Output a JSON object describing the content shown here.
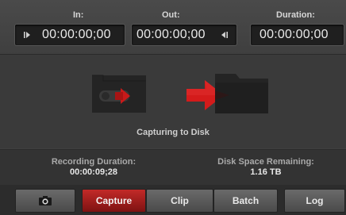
{
  "timecode": {
    "in_label": "In:",
    "out_label": "Out:",
    "duration_label": "Duration:",
    "in_value": "00:00:00;00",
    "out_value": "00:00:00;00",
    "duration_value": "00:00:00;00",
    "mark_in_icon": "mark-in-icon",
    "mark_out_icon": "mark-out-icon"
  },
  "stage": {
    "status": "Capturing to Disk",
    "icons": [
      "tape-icon",
      "arrow-right-icon",
      "folder-icon"
    ],
    "accent": "#d01818"
  },
  "info": {
    "recording_label": "Recording Duration:",
    "recording_value": "00:00:09;28",
    "disk_label": "Disk Space Remaining:",
    "disk_value": "1.16 TB"
  },
  "tabs": {
    "camera_icon": "camera-icon",
    "capture": "Capture",
    "clip": "Clip",
    "batch": "Batch",
    "log": "Log",
    "active": "capture"
  }
}
